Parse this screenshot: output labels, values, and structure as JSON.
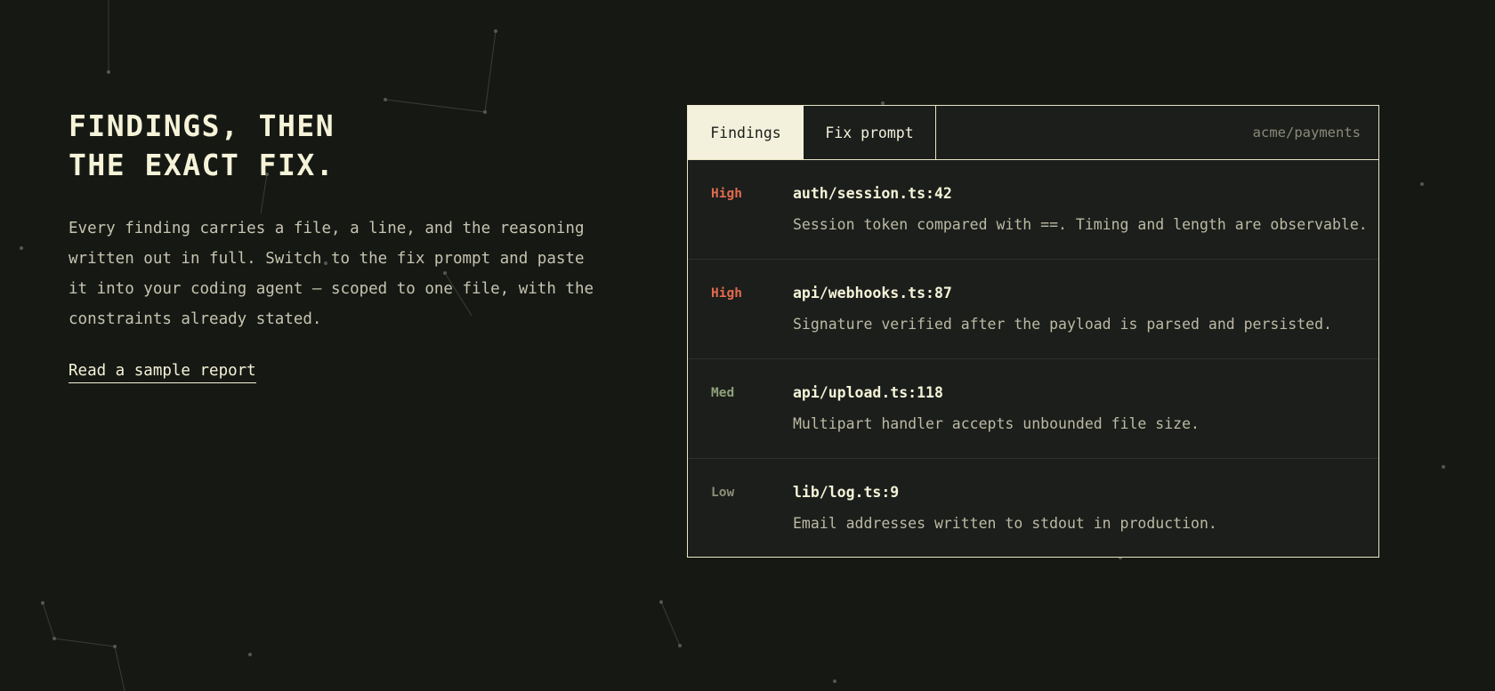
{
  "hero": {
    "title_line1": "FINDINGS, THEN",
    "title_line2": "THE EXACT FIX.",
    "description": "Every finding carries a file, a line, and the reasoning written out in full. Switch to the fix prompt and paste it into your coding agent — scoped to one file, with the constraints already stated.",
    "cta_label": "Read a sample report"
  },
  "panel": {
    "tabs": [
      {
        "label": "Findings",
        "active": true
      },
      {
        "label": "Fix prompt",
        "active": false
      }
    ],
    "repo": "acme/payments",
    "findings": [
      {
        "severity": "High",
        "severity_color": "#e06a4f",
        "file": "auth/session.ts:42",
        "message": "Session token compared with ==. Timing and length are observable."
      },
      {
        "severity": "High",
        "severity_color": "#e06a4f",
        "file": "api/webhooks.ts:87",
        "message": "Signature verified after the payload is parsed and persisted."
      },
      {
        "severity": "Med",
        "severity_color": "#8fa07a",
        "file": "api/upload.ts:118",
        "message": "Multipart handler accepts unbounded file size."
      },
      {
        "severity": "Low",
        "severity_color": "#8f8e78",
        "file": "lib/log.ts:9",
        "message": "Email addresses written to stdout in production."
      }
    ]
  },
  "colors": {
    "background": "#161814",
    "panel_border": "#e9e6c4",
    "accent_text": "#f5f3d8"
  }
}
